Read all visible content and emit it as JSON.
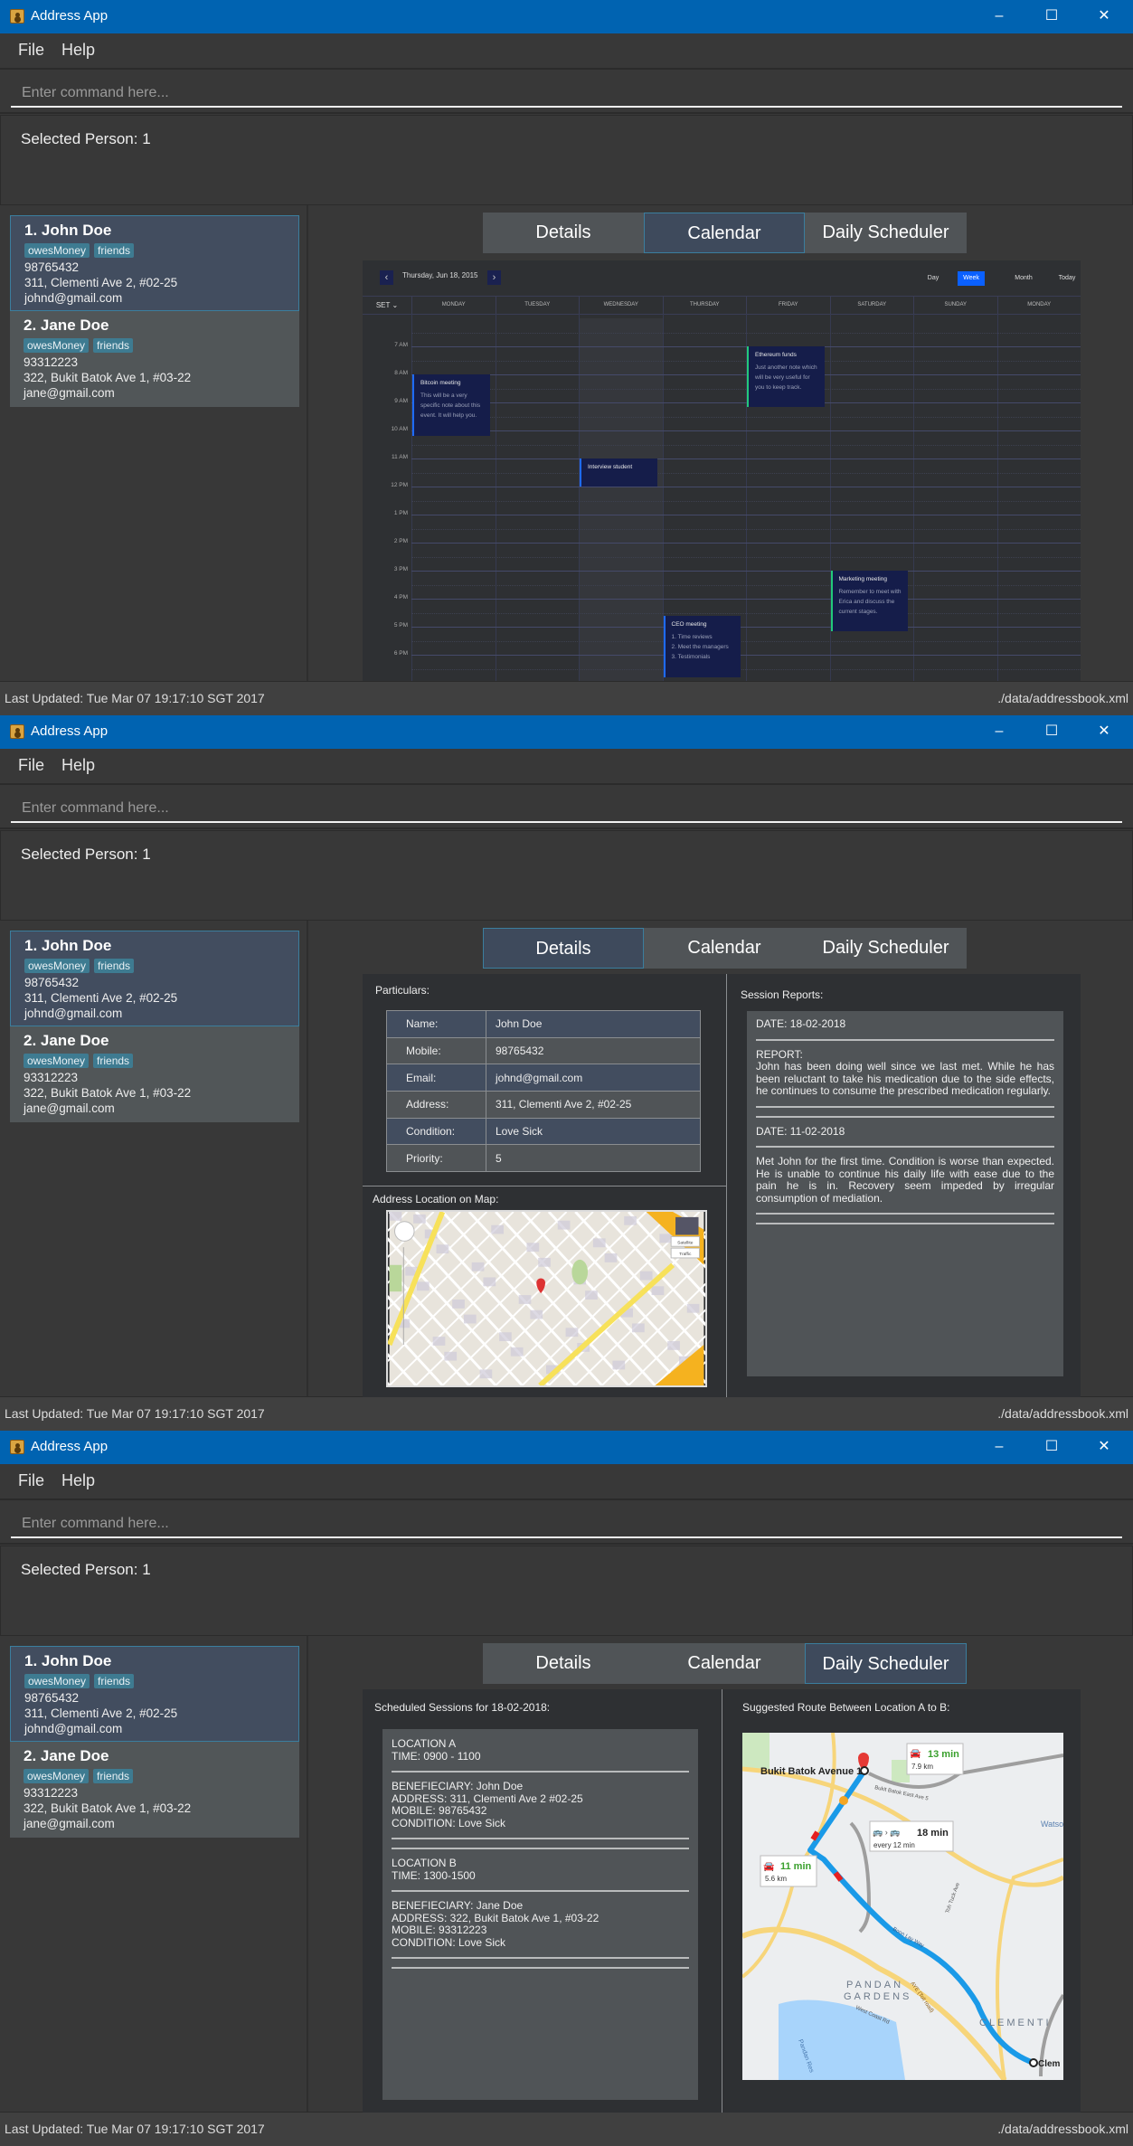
{
  "app": {
    "title": "Address App",
    "menu": [
      "File",
      "Help"
    ],
    "command_placeholder": "Enter command here...",
    "result_text": "Selected Person: 1",
    "status_left": "Last Updated: Tue Mar 07 19:17:10 SGT 2017",
    "status_right": "./data/addressbook.xml",
    "window_controls": [
      "minimize-icon",
      "maximize-icon",
      "close-icon"
    ]
  },
  "persons": [
    {
      "name": "1. John Doe",
      "tags": [
        "owesMoney",
        "friends"
      ],
      "phone": "98765432",
      "address": "311, Clementi Ave 2, #02-25",
      "email": "johnd@gmail.com",
      "selected": true
    },
    {
      "name": "2. Jane Doe",
      "tags": [
        "owesMoney",
        "friends"
      ],
      "phone": "93312223",
      "address": "322, Bukit Batok Ave 1, #03-22",
      "email": "jane@gmail.com",
      "selected": false
    }
  ],
  "tabs": [
    "Details",
    "Calendar",
    "Daily Scheduler"
  ],
  "windows": [
    {
      "active_tab": 1,
      "view": "calendar"
    },
    {
      "active_tab": 0,
      "view": "details"
    },
    {
      "active_tab": 2,
      "view": "scheduler"
    }
  ],
  "calendar": {
    "date_label": "Thursday, Jun 18, 2015",
    "prev_icon": "‹",
    "next_icon": "›",
    "views": [
      "Day",
      "Week",
      "Month",
      "Today"
    ],
    "active_view": 1,
    "timezone_label": "SET ⌄",
    "days": [
      "MONDAY",
      "TUESDAY",
      "WEDNESDAY",
      "THURSDAY",
      "FRIDAY",
      "SATURDAY",
      "SUNDAY",
      "MONDAY"
    ],
    "highlighted_day": 2,
    "hours": [
      "7 AM",
      "8 AM",
      "9 AM",
      "10 AM",
      "11 AM",
      "12 PM",
      "1 PM",
      "2 PM",
      "3 PM",
      "4 PM",
      "5 PM",
      "6 PM"
    ],
    "events": [
      {
        "title": "Bitcoin meeting",
        "note": "This will be a very specific note about this event. It will help you.",
        "day": 0,
        "start": 8.0,
        "end": 10.2,
        "accent": "#1e6bff"
      },
      {
        "title": "Interview student",
        "note": "",
        "day": 2,
        "start": 11.0,
        "end": 12.0,
        "accent": "#1e6bff"
      },
      {
        "title": "Ethereum funds",
        "note": "Just another note which will be very useful for you to keep track.",
        "day": 4,
        "start": 7.0,
        "end": 9.15,
        "accent": "#22c97a"
      },
      {
        "title": "Marketing meeting",
        "note": "Remember to meet with Erica and discuss the current stages.",
        "day": 5,
        "start": 15.0,
        "end": 17.15,
        "accent": "#22c97a"
      },
      {
        "title": "CEO meeting",
        "note": "1. Time reviews\n2. Meet the managers\n3. Testimonials",
        "day": 3,
        "start": 16.6,
        "end": 18.8,
        "accent": "#1e6bff"
      }
    ]
  },
  "details": {
    "particulars_label": "Particulars:",
    "rows": [
      {
        "label": "Name:",
        "value": "John Doe"
      },
      {
        "label": "Mobile:",
        "value": "98765432"
      },
      {
        "label": "Email:",
        "value": "johnd@gmail.com"
      },
      {
        "label": "Address:",
        "value": "311, Clementi Ave 2, #02-25"
      },
      {
        "label": "Condition:",
        "value": "Love Sick"
      },
      {
        "label": "Priority:",
        "value": "5"
      }
    ],
    "map_label": "Address Location on Map:",
    "map_buttons": [
      "Satellite",
      "Traffic"
    ],
    "reports_label": "Session Reports:",
    "reports": [
      {
        "date": "DATE: 18-02-2018",
        "text": "REPORT:\nJohn has been doing well since we last met. While he has been reluctant to take his medication due to the side effects, he continues to consume the prescribed medication regularly."
      },
      {
        "date": "DATE: 11-02-2018",
        "text": "Met John for the first time. Condition is worse than expected. He is unable to continue his daily life with ease due to the pain he is in. Recovery seem impeded by irregular consumption of mediation."
      }
    ]
  },
  "scheduler": {
    "sessions_label": "Scheduled Sessions for 18-02-2018:",
    "sessions": [
      {
        "location": "LOCATION A",
        "time": "TIME: 0900 - 1100",
        "beneficiary": "BENEFIECIARY: John Doe",
        "address": "ADDRESS: 311, Clementi Ave 2 #02-25",
        "mobile": "MOBILE: 98765432",
        "condition": "CONDITION: Love Sick"
      },
      {
        "location": "LOCATION B",
        "time": "TIME: 1300-1500",
        "beneficiary": "BENEFIECIARY: Jane Doe",
        "address": "ADDRESS: 322, Bukit Batok Ave 1, #03-22",
        "mobile": "MOBILE: 93312223",
        "condition": "CONDITION: Love Sick"
      }
    ],
    "route_label": "Suggested Route Between Location A to B:",
    "map": {
      "start_label": "Bukit Batok Avenue 1",
      "end_label": "Clem",
      "car_time_1": "13 min",
      "car_dist_1": "7.9 km",
      "bus_time": "18 min",
      "bus_freq": "every 12 min",
      "car_time_2": "11 min",
      "car_dist_2": "5.6 km",
      "area_1": "PANDAN",
      "area_2": "GARDENS",
      "area_3": "CLEMENTI",
      "road_1": "Bukit Batok East Ave 5",
      "road_2": "Boon Lay Way",
      "road_3": "AYE (Toll road)",
      "road_4": "West Coast Rd",
      "road_5": "Toh Tuck Ave",
      "water": "Pandan Res",
      "other": "Watso"
    }
  },
  "colors": {
    "titlebar": "#0063b1",
    "accent_blue": "#1e6bff",
    "accent_green": "#22c97a",
    "tag": "#3e7b91",
    "selected_card": "#424d5f"
  }
}
